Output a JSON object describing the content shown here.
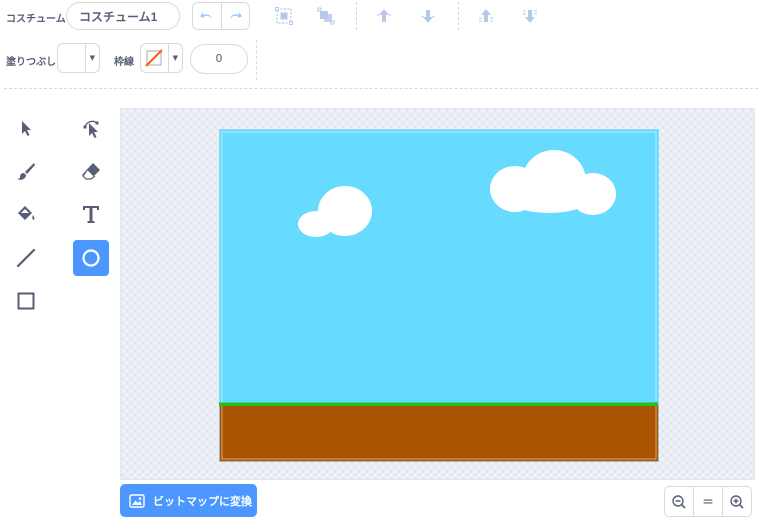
{
  "toolbar": {
    "costume_label": "コスチューム",
    "costume_name": "コスチューム1",
    "fill_label": "塗りつぶし",
    "outline_label": "枠線",
    "outline_width": "0"
  },
  "colors": {
    "accent": "#4c97ff",
    "icon": "#575e75",
    "disabled_icon": "#b5c8e8",
    "sky": "#66dbff",
    "ground": "#aa5300",
    "grass": "#1ac41a",
    "outline_slash": "#ff5a1a"
  },
  "tools": {
    "left": [
      "select-icon",
      "brush-icon",
      "fill-icon",
      "line-icon",
      "rectangle-icon"
    ],
    "right": [
      "reshape-icon",
      "eraser-icon",
      "text-icon",
      "circle-icon"
    ],
    "selected": "circle-icon"
  },
  "bottom": {
    "convert_bitmap": "ビットマップに変換",
    "zoom_reset": "="
  }
}
